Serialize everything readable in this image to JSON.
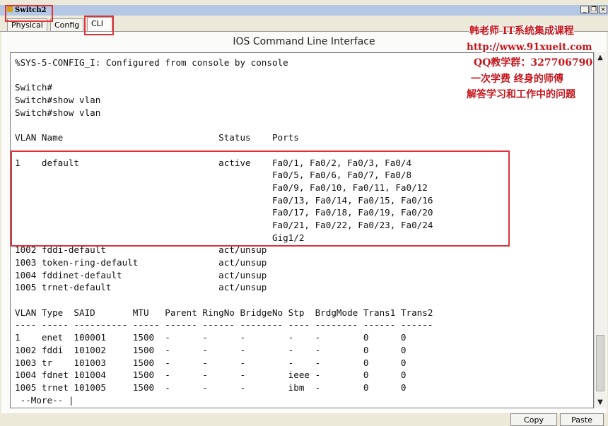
{
  "window": {
    "title": "Switch2",
    "controls": {
      "minimize": "_",
      "restore": "❐",
      "close": "×"
    }
  },
  "tabs": [
    {
      "label": "Physical"
    },
    {
      "label": "Config"
    },
    {
      "label": "CLI"
    }
  ],
  "active_tab": "CLI",
  "panel": {
    "title": "IOS Command Line Interface"
  },
  "console": {
    "lines": [
      "%SYS-5-CONFIG_I: Configured from console by console",
      "",
      "Switch#",
      "Switch#show vlan",
      "Switch#show vlan",
      "",
      "VLAN Name                             Status    Ports",
      "---- -------------------------------- --------- -------------------------------",
      "1    default                          active    Fa0/1, Fa0/2, Fa0/3, Fa0/4",
      "                                                Fa0/5, Fa0/6, Fa0/7, Fa0/8",
      "                                                Fa0/9, Fa0/10, Fa0/11, Fa0/12",
      "                                                Fa0/13, Fa0/14, Fa0/15, Fa0/16",
      "                                                Fa0/17, Fa0/18, Fa0/19, Fa0/20",
      "                                                Fa0/21, Fa0/22, Fa0/23, Fa0/24",
      "                                                Gig1/2",
      "1002 fddi-default                     act/unsup",
      "1003 token-ring-default               act/unsup",
      "1004 fddinet-default                  act/unsup",
      "1005 trnet-default                    act/unsup",
      "",
      "VLAN Type  SAID       MTU   Parent RingNo BridgeNo Stp  BrdgMode Trans1 Trans2",
      "---- ----- ---------- ----- ------ ------ -------- ---- -------- ------ ------",
      "1    enet  100001     1500  -      -      -        -    -        0      0",
      "1002 fddi  101002     1500  -      -      -        -    -        0      0",
      "1003 tr    101003     1500  -      -      -        -    -        0      0",
      "1004 fdnet 101004     1500  -      -      -        ieee -        0      0",
      "1005 trnet 101005     1500  -      -      -        ibm  -        0      0",
      " --More-- |"
    ]
  },
  "footer": {
    "copy_label": "Copy",
    "paste_label": "Paste"
  },
  "overlay": {
    "lines": [
      "韩老师 IT系统集成课程",
      "http://www.91xueit.com",
      "QQ教学群：327706790",
      "一次学费   终身的师傅",
      "解答学习和工作中的问题"
    ]
  },
  "colors": {
    "annotation": "#e0323a",
    "overlay_text": "#c4161c"
  }
}
